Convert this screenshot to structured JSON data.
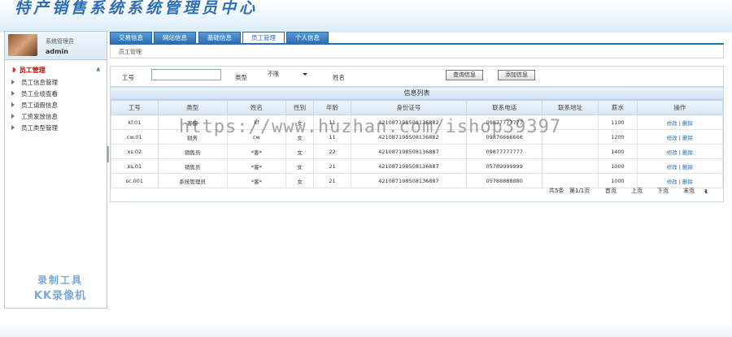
{
  "app": {
    "title": "特产销售系统系统管理员中心"
  },
  "user": {
    "role_label": "系统管理员",
    "username": "admin"
  },
  "sidebar": {
    "section_title": "员工管理",
    "collapse_label": "∧",
    "items": [
      {
        "label": "员工信息管理"
      },
      {
        "label": "员工业绩查看"
      },
      {
        "label": "员工请假信息"
      },
      {
        "label": "工资发放信息"
      },
      {
        "label": "员工类型管理"
      }
    ]
  },
  "recorder_watermark": {
    "line1": "录制工具",
    "line2": "KK录像机"
  },
  "tabs": [
    {
      "label": "交易信息"
    },
    {
      "label": "网站信息"
    },
    {
      "label": "基础信息"
    },
    {
      "label": "员工管理"
    },
    {
      "label": "个人信息"
    }
  ],
  "breadcrumb": "员工管理",
  "search": {
    "id_label": "工号",
    "type_label": "类型",
    "type_value": "不限",
    "name_label": "姓名",
    "query_button": "查询信息",
    "add_button": "添加信息"
  },
  "grid": {
    "title": "信息列表",
    "columns": [
      "工号",
      "类型",
      "姓名",
      "性别",
      "年龄",
      "身份证号",
      "联系电话",
      "联系地址",
      "薪水",
      "操作"
    ],
    "rows": [
      {
        "id": "kf.01",
        "type": "客服",
        "name": "kf",
        "gender": "女",
        "age": "11",
        "idcard": "421087198508136882",
        "phone": "09877777777",
        "address": "",
        "salary": "1100",
        "edit": "修改",
        "delete": "删除"
      },
      {
        "id": "cw.01",
        "type": "财务",
        "name": "cw",
        "gender": "女",
        "age": "11",
        "idcard": "421087198508136882",
        "phone": "09876666666",
        "address": "",
        "salary": "1200",
        "edit": "修改",
        "delete": "删除"
      },
      {
        "id": "xs.02",
        "type": "销售员",
        "name": "*客*",
        "gender": "女",
        "age": "22",
        "idcard": "421087198508136887",
        "phone": "09877777777",
        "address": "",
        "salary": "1400",
        "edit": "修改",
        "delete": "删除"
      },
      {
        "id": "xs.01",
        "type": "销售员",
        "name": "*客*",
        "gender": "女",
        "age": "21",
        "idcard": "421087198508136887",
        "phone": "05789999999",
        "address": "",
        "salary": "1000",
        "edit": "修改",
        "delete": "删除"
      },
      {
        "id": "sc.001",
        "type": "系统管理员",
        "name": "*客*",
        "gender": "女",
        "age": "21",
        "idcard": "421087198508136887",
        "phone": "05788888880",
        "address": "",
        "salary": "1000",
        "edit": "修改",
        "delete": "删除"
      }
    ]
  },
  "pager": {
    "total": "共5条",
    "page": "第1/1页",
    "first": "首页",
    "prev": "上页",
    "next": "下页",
    "last": "末页",
    "page_select": "1"
  },
  "overlay_watermark": "https://www.huzhan.com/ishop39397"
}
